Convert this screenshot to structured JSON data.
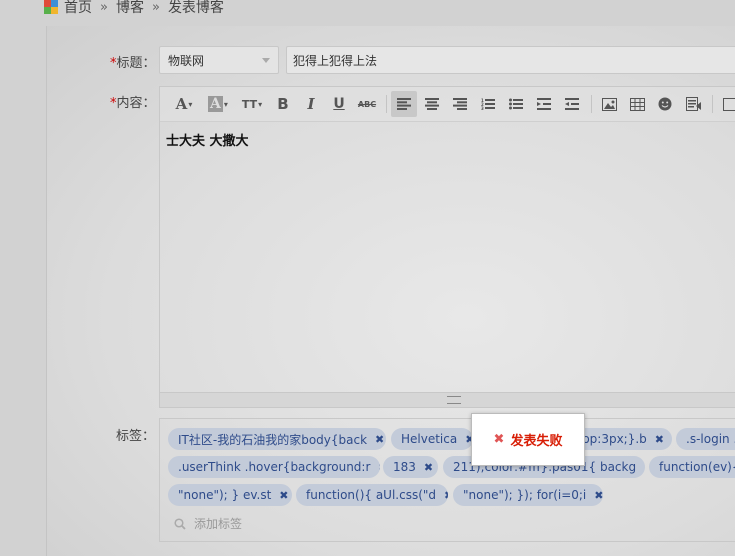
{
  "breadcrumb": {
    "home": "首页",
    "sep": "»",
    "section": "博客",
    "current": "发表博客"
  },
  "form": {
    "title_label": "标题：",
    "content_label": "内容：",
    "tags_label": "标签：",
    "required_mark": "*",
    "category_value": "物联网",
    "title_value": "犯得上犯得上法",
    "content_text": "士大夫 大撒大"
  },
  "toolbar": {
    "buttons": [
      "font-size",
      "font-color",
      "text-format",
      "bold",
      "italic",
      "underline",
      "strikethrough",
      "align-left",
      "align-center",
      "align-right",
      "ordered-list",
      "unordered-list",
      "indent",
      "outdent",
      "image",
      "table",
      "emoticon",
      "code",
      "more"
    ]
  },
  "tags": [
    "IT社区-我的石油我的家body{back",
    "Helvetica",
    "top:3px;}.b",
    ".s-login .l",
    ".userThink .hover{background:r",
    "183",
    "211);color:#fff}.pas01{ backg",
    "function(ev){",
    "\"none\"); } ev.st",
    "function(){ aUl.css(\"d",
    "\"none\"); }); for(i=0;i"
  ],
  "tag_remove_symbol": "✖",
  "add_tag_placeholder": "添加标签",
  "toast": {
    "message": "发表失败",
    "icon": "✖"
  },
  "colors": {
    "tag_bg": "#c3cbd9",
    "tag_text": "#2e4b8a",
    "error": "#d81e06",
    "required": "#cc0000"
  }
}
